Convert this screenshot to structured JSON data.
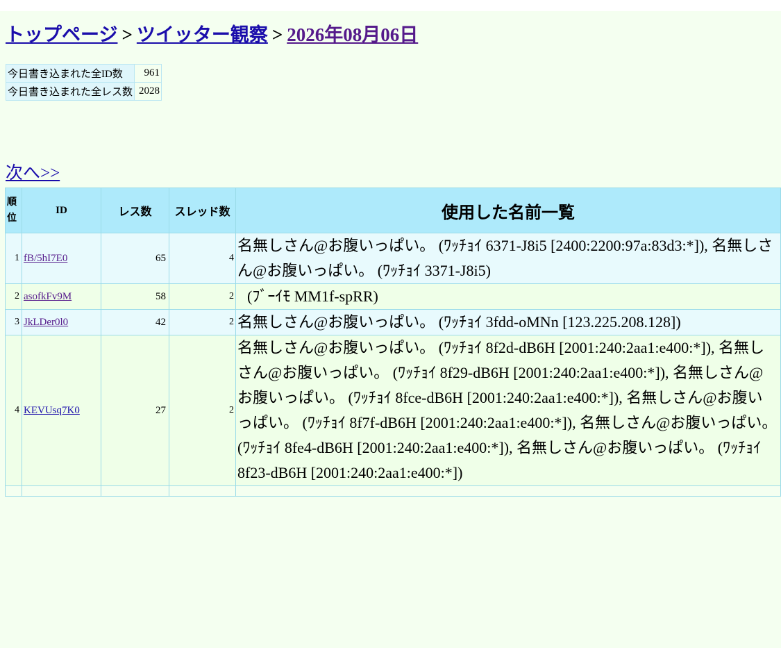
{
  "breadcrumb": {
    "home": "トップページ",
    "sep1": ">",
    "board": "ツイッター観察",
    "sep2": ">",
    "date": "2026年08月06日"
  },
  "stats": [
    {
      "label": "今日書き込まれた全ID数",
      "value": "961"
    },
    {
      "label": "今日書き込まれた全レス数",
      "value": "2028"
    }
  ],
  "next_link": "次へ>>",
  "table": {
    "headers": {
      "rank": "順位",
      "id": "ID",
      "res": "レス数",
      "threads": "スレッド数",
      "names": "使用した名前一覧"
    },
    "rows": [
      {
        "rank": "1",
        "id": "fB/5hI7E0",
        "res": "65",
        "threads": "4",
        "names": "名無しさん@お腹いっぱい。 (ﾜｯﾁｮｲ 6371-J8i5 [2400:2200:97a:83d3:*]), 名無しさん@お腹いっぱい。 (ﾜｯﾁｮｲ 3371-J8i5)"
      },
      {
        "rank": "2",
        "id": "asofkFv9M",
        "res": "58",
        "threads": "2",
        "names": " (ﾌﾞｰｲﾓ MM1f-spRR)"
      },
      {
        "rank": "3",
        "id": "JkLDer0l0",
        "res": "42",
        "threads": "2",
        "names": "名無しさん@お腹いっぱい。 (ﾜｯﾁｮｲ 3fdd-oMNn [123.225.208.128])"
      },
      {
        "rank": "4",
        "id": "KEVUsq7K0",
        "res": "27",
        "threads": "2",
        "names": "名無しさん@お腹いっぱい。 (ﾜｯﾁｮｲ 8f2d-dB6H [2001:240:2aa1:e400:*]), 名無しさん@お腹いっぱい。 (ﾜｯﾁｮｲ 8f29-dB6H [2001:240:2aa1:e400:*]), 名無しさん@お腹いっぱい。 (ﾜｯﾁｮｲ 8fce-dB6H [2001:240:2aa1:e400:*]), 名無しさん@お腹いっぱい。 (ﾜｯﾁｮｲ 8f7f-dB6H [2001:240:2aa1:e400:*]), 名無しさん@お腹いっぱい。 (ﾜｯﾁｮｲ 8fe4-dB6H [2001:240:2aa1:e400:*]), 名無しさん@お腹いっぱい。 (ﾜｯﾁｮｲ 8f23-dB6H [2001:240:2aa1:e400:*])"
      }
    ]
  },
  "colors": {
    "page_bg": "#f4fff0",
    "header_bg": "#aeeafb",
    "row_blue": "#e8fafd",
    "row_green": "#efffe8",
    "link": "#1a0dab",
    "visited": "#551a8b"
  }
}
